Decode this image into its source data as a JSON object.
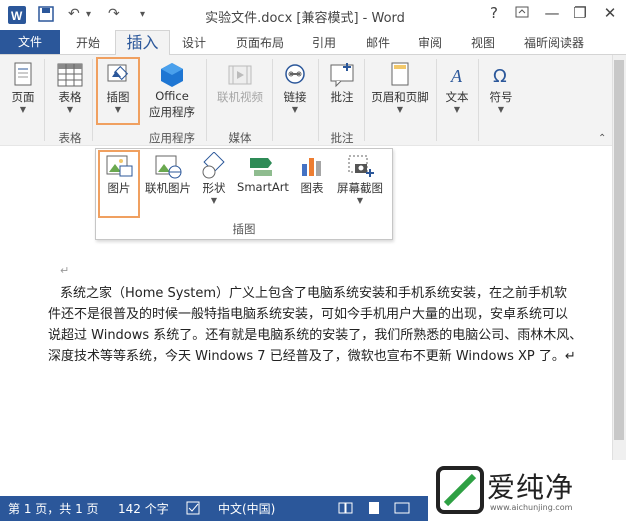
{
  "window": {
    "title": "实验文件.docx [兼容模式] - Word",
    "help": "?",
    "minimize": "—",
    "restore": "❐",
    "close": "✕"
  },
  "quick_access": {
    "undo": "↶",
    "redo": "↷",
    "more": "▾"
  },
  "tabs": [
    {
      "label": "文件"
    },
    {
      "label": "开始"
    },
    {
      "label": "插入"
    },
    {
      "label": "设计"
    },
    {
      "label": "页面布局"
    },
    {
      "label": "引用"
    },
    {
      "label": "邮件"
    },
    {
      "label": "审阅"
    },
    {
      "label": "视图"
    },
    {
      "label": "福昕阅读器"
    }
  ],
  "ribbon": {
    "page": "页面",
    "table": "表格",
    "illustrations": "插图",
    "office_apps_1": "Office",
    "office_apps_2": "应用程序",
    "online_video": "联机视频",
    "link": "链接",
    "comment": "批注",
    "header_footer": "页眉和页脚",
    "text": "文本",
    "symbol": "符号",
    "groups": {
      "table": "表格",
      "apps": "应用程序",
      "media": "媒体",
      "comments": "批注"
    }
  },
  "dropdown": {
    "picture": "图片",
    "online_picture": "联机图片",
    "shapes": "形状",
    "smartart": "SmartArt",
    "chart": "图表",
    "screenshot": "屏幕截图",
    "group_label": "插图"
  },
  "document": {
    "para_mark": "↵",
    "line1": "系统之家（Home System）广义上包含了电脑系统安装和手机系统安装，在之前手机软",
    "line2": "件还不是很普及的时候一般特指电脑系统安装，可如今手机用户大量的出现，安卓系统可以",
    "line3": "说超过 Windows 系统了。还有就是电脑系统的安装了，我们所熟悉的电脑公司、雨林木风、",
    "line4": "深度技术等等系统，今天 Windows 7 已经普及了，微软也宣布不更新 Windows XP 了。↵"
  },
  "status": {
    "page": "第 1 页，共 1 页",
    "words": "142 个字",
    "language": "中文(中国)"
  },
  "watermark": {
    "text": "爱纯净",
    "url": "www.aichunjing.com"
  },
  "colors": {
    "accent": "#2b579a",
    "highlight": "#f0a060"
  }
}
